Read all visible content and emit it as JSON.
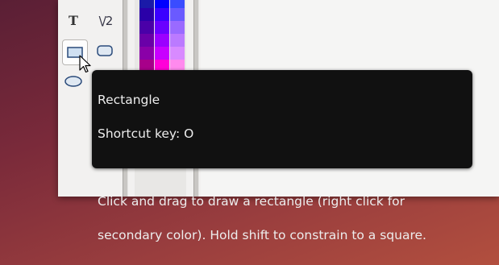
{
  "toolbox": {
    "tools": [
      {
        "name": "text-tool",
        "glyph": "T"
      },
      {
        "name": "line-curve-tool",
        "glyph": "\\/2"
      },
      {
        "name": "rectangle-tool",
        "glyph": ""
      },
      {
        "name": "rounded-rectangle-tool",
        "glyph": ""
      },
      {
        "name": "ellipse-tool",
        "glyph": ""
      }
    ]
  },
  "palette": {
    "colors": [
      [
        "#1a1aa8",
        "#0000ff",
        "#3a4cff"
      ],
      [
        "#2a00a8",
        "#3b00ff",
        "#6a5aff"
      ],
      [
        "#4a00a8",
        "#6a00ff",
        "#9a6aff"
      ],
      [
        "#6a00a8",
        "#9b00ff",
        "#bb7aff"
      ],
      [
        "#8a00a8",
        "#c800ff",
        "#d88aff"
      ],
      [
        "#a8008a",
        "#ff00d8",
        "#ff8aee"
      ],
      [
        "#a80070",
        "#ff00b0",
        "#ff8ad2"
      ]
    ]
  },
  "tooltip": {
    "title": "Rectangle",
    "shortcut": "Shortcut key: O",
    "description_line1": "Click and drag to draw a rectangle (right click for",
    "description_line2": "secondary color). Hold shift to constrain to a square."
  }
}
